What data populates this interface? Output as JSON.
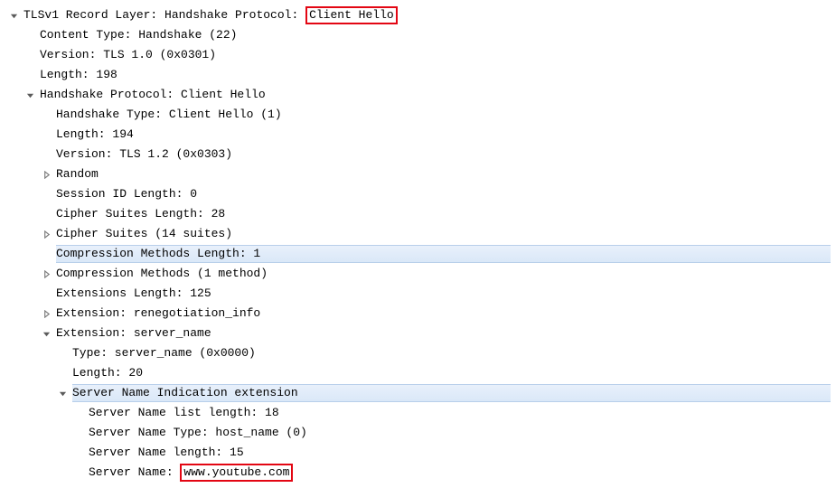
{
  "tree": {
    "l0": {
      "prefix": "TLSv1 Record Layer: Handshake Protocol: ",
      "highlight": "Client Hello"
    },
    "l1": "Content Type: Handshake (22)",
    "l2": "Version: TLS 1.0 (0x0301)",
    "l3": "Length: 198",
    "l4": "Handshake Protocol: Client Hello",
    "l5": "Handshake Type: Client Hello (1)",
    "l6": "Length: 194",
    "l7": "Version: TLS 1.2 (0x0303)",
    "l8": "Random",
    "l9": "Session ID Length: 0",
    "l10": "Cipher Suites Length: 28",
    "l11": "Cipher Suites (14 suites)",
    "l12": "Compression Methods Length: 1",
    "l13": "Compression Methods (1 method)",
    "l14": "Extensions Length: 125",
    "l15": "Extension: renegotiation_info",
    "l16": "Extension: server_name",
    "l17": "Type: server_name (0x0000)",
    "l18": "Length: 20",
    "l19": "Server Name Indication extension",
    "l20": "Server Name list length: 18",
    "l21": "Server Name Type: host_name (0)",
    "l22": "Server Name length: 15",
    "l23": {
      "prefix": "Server Name: ",
      "highlight": "www.youtube.com"
    }
  }
}
